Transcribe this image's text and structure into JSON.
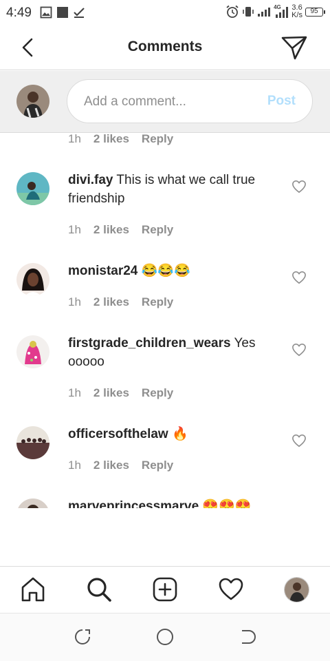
{
  "status_bar": {
    "time": "4:49",
    "net_speed_value": "3.6",
    "net_speed_unit": "K/s",
    "network_type": "4G",
    "battery": "95",
    "left_icons": [
      "image-icon",
      "square-icon",
      "download-done-icon"
    ],
    "right_icons": [
      "alarm-icon",
      "vibrate-icon",
      "signal-icon",
      "signal-4g-icon"
    ]
  },
  "header": {
    "title": "Comments",
    "back_icon": "chevron-left-icon",
    "send_icon": "paper-plane-icon"
  },
  "composer": {
    "placeholder": "Add a comment...",
    "post_label": "Post",
    "post_color": "#b2dffc"
  },
  "partial_meta": {
    "time": "1h",
    "likes": "2 likes",
    "reply": "Reply"
  },
  "comments": [
    {
      "username": "divi.fay",
      "text": "This is what we call true friendship",
      "time": "1h",
      "likes": "2 likes",
      "reply": "Reply"
    },
    {
      "username": "monistar24",
      "text": "😂😂😂",
      "time": "1h",
      "likes": "2 likes",
      "reply": "Reply"
    },
    {
      "username": "firstgrade_children_wears",
      "text": "Yes ooooo",
      "time": "1h",
      "likes": "2 likes",
      "reply": "Reply"
    },
    {
      "username": "officersofthelaw",
      "text": "🔥",
      "time": "1h",
      "likes": "2 likes",
      "reply": "Reply"
    },
    {
      "username": "marveprincessmarve",
      "text": "😍😍😍"
    }
  ],
  "bottom_nav": {
    "items": [
      "home-icon",
      "search-icon",
      "add-post-icon",
      "activity-heart-icon",
      "profile-avatar"
    ]
  },
  "system_nav": {
    "items": [
      "recents-icon",
      "home-circle-icon",
      "back-icon"
    ]
  },
  "colors": {
    "text_primary": "#262626",
    "text_secondary": "#8e8e8e",
    "divider": "#dbdbdb",
    "post_disabled": "#b2dffc"
  }
}
